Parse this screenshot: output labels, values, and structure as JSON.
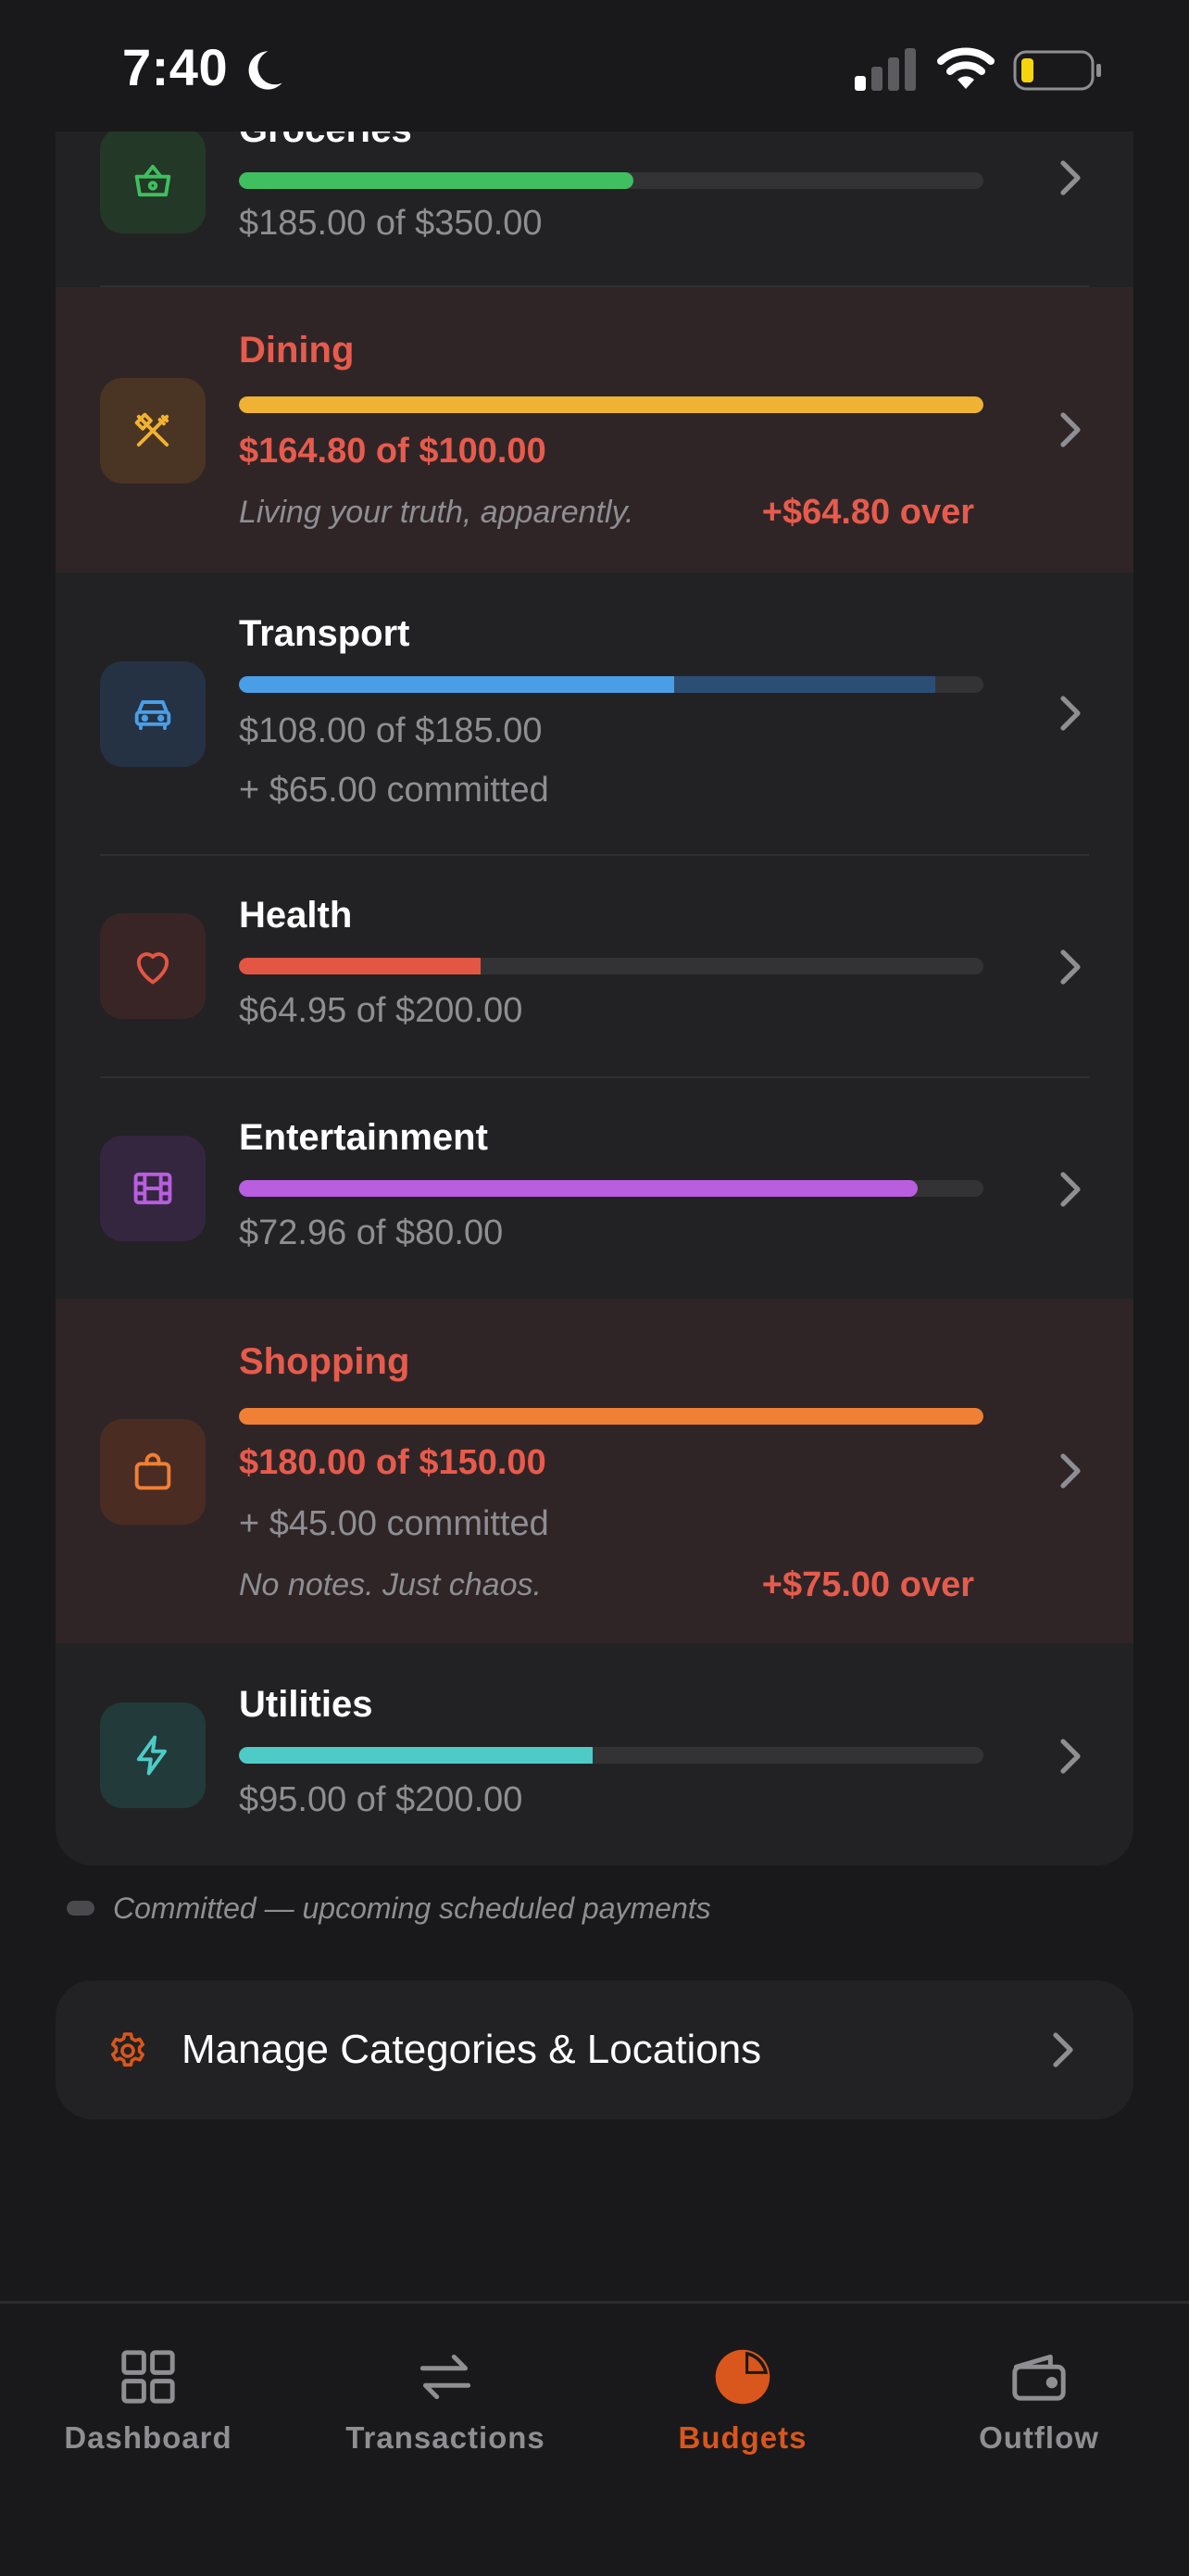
{
  "status_bar": {
    "time": "7:40"
  },
  "colors": {
    "accent": "#d9561c",
    "over": "#e75b4d",
    "committed": "#2b4e74"
  },
  "categories": [
    {
      "name": "Groceries",
      "icon": "basket-icon",
      "color": "#3fbf5f",
      "progress": 0.53,
      "amount": "$185.00 of $350.00",
      "over": false
    },
    {
      "name": "Dining",
      "icon": "fork-knife-icon",
      "color": "#f0b232",
      "progress": 1.0,
      "amount": "$164.80 of $100.00",
      "note": "Living your truth, apparently.",
      "over_amount": "+$64.80 over",
      "over": true
    },
    {
      "name": "Transport",
      "icon": "car-icon",
      "color": "#4a9ee6",
      "progress": 0.584,
      "committed_progress": 0.351,
      "amount": "$108.00 of $185.00",
      "committed": "+ $65.00 committed",
      "over": false
    },
    {
      "name": "Health",
      "icon": "heart-icon",
      "color": "#e35644",
      "progress": 0.325,
      "amount": "$64.95 of $200.00",
      "over": false
    },
    {
      "name": "Entertainment",
      "icon": "film-icon",
      "color": "#b85ede",
      "progress": 0.912,
      "amount": "$72.96 of $80.00",
      "over": false
    },
    {
      "name": "Shopping",
      "icon": "shopping-bag-icon",
      "color": "#f08035",
      "progress": 1.0,
      "amount": "$180.00 of $150.00",
      "committed": "+ $45.00 committed",
      "note": "No notes. Just chaos.",
      "over_amount": "+$75.00 over",
      "over": true
    },
    {
      "name": "Utilities",
      "icon": "lightning-icon",
      "color": "#4ecbc6",
      "progress": 0.475,
      "amount": "$95.00 of $200.00",
      "over": false
    }
  ],
  "legend": {
    "text": "Committed — upcoming scheduled payments"
  },
  "manage": {
    "label": "Manage Categories & Locations",
    "icon": "gear-icon"
  },
  "tabs": [
    {
      "label": "Dashboard",
      "icon": "grid-icon",
      "active": false
    },
    {
      "label": "Transactions",
      "icon": "arrows-swap-icon",
      "active": false
    },
    {
      "label": "Budgets",
      "icon": "pie-chart-icon",
      "active": true
    },
    {
      "label": "Outflow",
      "icon": "wallet-icon",
      "active": false
    }
  ]
}
